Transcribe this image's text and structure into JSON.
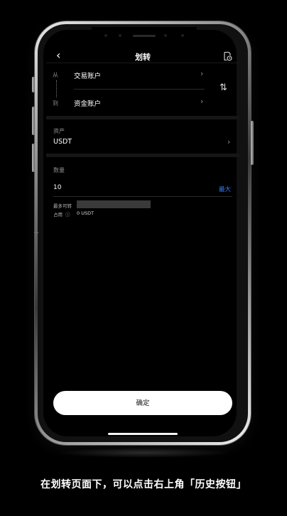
{
  "nav": {
    "title": "划转",
    "back_icon": "chevron-left-icon",
    "history_icon": "history-icon"
  },
  "transfer": {
    "from_label": "从",
    "from_account": "交易账户",
    "to_label": "到",
    "to_account": "资金账户",
    "swap_icon": "swap-vertical-icon"
  },
  "asset": {
    "label": "资产",
    "value": "USDT"
  },
  "quantity": {
    "label": "数量",
    "value": "10",
    "max_label": "最大",
    "max_available_label": "最多可转",
    "occupied_label": "占用",
    "occupied_value": "0 USDT"
  },
  "confirm_button": "确定",
  "caption": "在划转页面下，可以点击右上角「历史按钮」",
  "colors": {
    "accent": "#2e7df7",
    "background": "#000000",
    "button_bg": "#ffffff"
  }
}
